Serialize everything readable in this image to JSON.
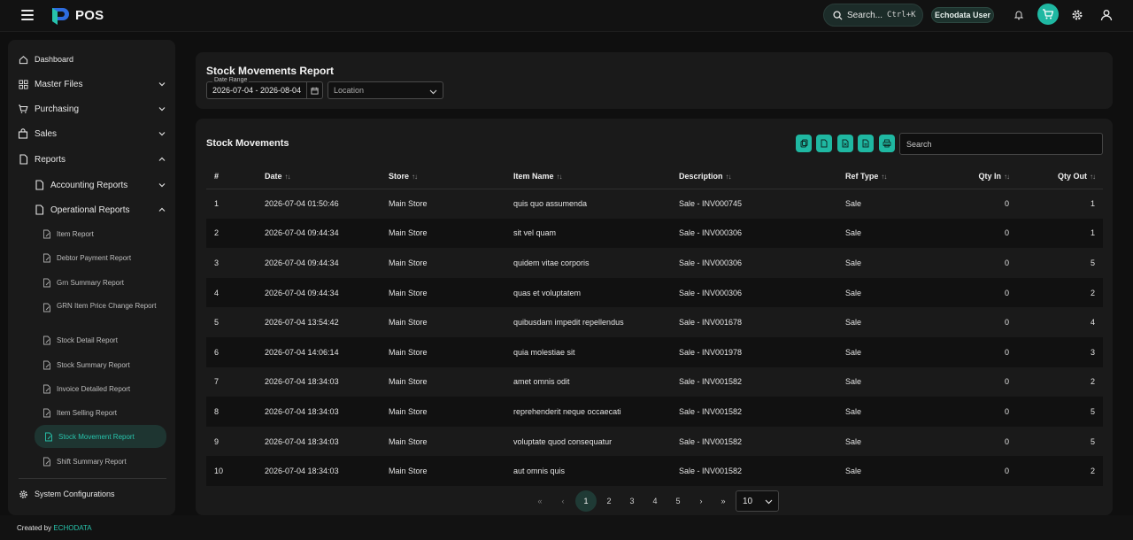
{
  "app": {
    "title": "POS"
  },
  "header": {
    "search_label": "Search...",
    "search_shortcut": "Ctrl+K",
    "user_name": "Echodata User"
  },
  "sidebar": {
    "dashboard": "Dashboard",
    "master_files": "Master Files",
    "purchasing": "Purchasing",
    "sales": "Sales",
    "reports": "Reports",
    "accounting_reports": "Accounting Reports",
    "operational_reports": "Operational Reports",
    "report_items": [
      "Item Report",
      "Debtor Payment Report",
      "Grn Summary Report",
      "GRN Item Price Change Report",
      "Stock Detail Report",
      "Stock Summary Report",
      "Invoice Detailed Report",
      "Item Selling Report",
      "Stock Movement Report",
      "Shift Summary Report"
    ],
    "active_item": "Stock Movement Report",
    "system_configurations": "System Configurations"
  },
  "filters": {
    "page_title": "Stock Movements Report",
    "date_range_label": "Date Range",
    "date_range_value": "2026-07-04 - 2026-08-04",
    "location_placeholder": "Location"
  },
  "table": {
    "title": "Stock Movements",
    "search_placeholder": "Search",
    "columns": [
      "#",
      "Date",
      "Store",
      "Item Name",
      "Description",
      "Ref Type",
      "Qty In",
      "Qty Out"
    ],
    "rows": [
      [
        "1",
        "2026-07-04 01:50:46",
        "Main Store",
        "quis quo assumenda",
        "Sale - INV000745",
        "Sale",
        "0",
        "1"
      ],
      [
        "2",
        "2026-07-04 09:44:34",
        "Main Store",
        "sit vel quam",
        "Sale - INV000306",
        "Sale",
        "0",
        "1"
      ],
      [
        "3",
        "2026-07-04 09:44:34",
        "Main Store",
        "quidem vitae corporis",
        "Sale - INV000306",
        "Sale",
        "0",
        "5"
      ],
      [
        "4",
        "2026-07-04 09:44:34",
        "Main Store",
        "quas et voluptatem",
        "Sale - INV000306",
        "Sale",
        "0",
        "2"
      ],
      [
        "5",
        "2026-07-04 13:54:42",
        "Main Store",
        "quibusdam impedit repellendus",
        "Sale - INV001678",
        "Sale",
        "0",
        "4"
      ],
      [
        "6",
        "2026-07-04 14:06:14",
        "Main Store",
        "quia molestiae sit",
        "Sale - INV001978",
        "Sale",
        "0",
        "3"
      ],
      [
        "7",
        "2026-07-04 18:34:03",
        "Main Store",
        "amet omnis odit",
        "Sale - INV001582",
        "Sale",
        "0",
        "2"
      ],
      [
        "8",
        "2026-07-04 18:34:03",
        "Main Store",
        "reprehenderit neque occaecati",
        "Sale - INV001582",
        "Sale",
        "0",
        "5"
      ],
      [
        "9",
        "2026-07-04 18:34:03",
        "Main Store",
        "voluptate quod consequatur",
        "Sale - INV001582",
        "Sale",
        "0",
        "5"
      ],
      [
        "10",
        "2026-07-04 18:34:03",
        "Main Store",
        "aut omnis quis",
        "Sale - INV001582",
        "Sale",
        "0",
        "2"
      ]
    ]
  },
  "pagination": {
    "pages": [
      "1",
      "2",
      "3",
      "4",
      "5"
    ],
    "current": "1",
    "page_size": "10"
  },
  "footer": {
    "prefix": "Created by",
    "brand": "ECHODATA"
  },
  "colors": {
    "accent": "#1fb8a2",
    "background": "#0f0f0f",
    "panel": "#1a1a1a"
  }
}
